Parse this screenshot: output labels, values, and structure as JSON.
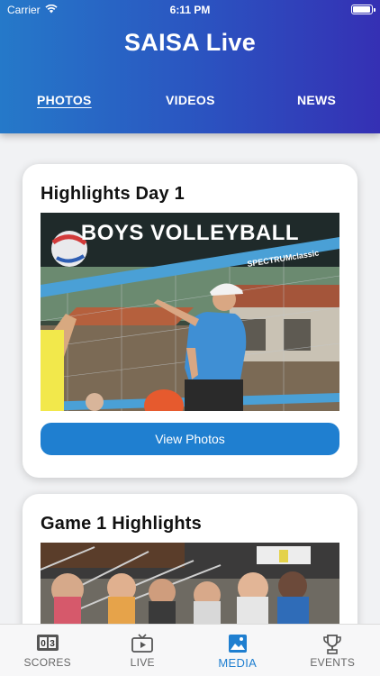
{
  "status_bar": {
    "carrier": "Carrier",
    "time": "6:11 PM"
  },
  "header": {
    "title": "SAISA Live"
  },
  "tabs": [
    {
      "label": "PHOTOS",
      "active": true
    },
    {
      "label": "VIDEOS",
      "active": false
    },
    {
      "label": "NEWS",
      "active": false
    }
  ],
  "cards": [
    {
      "title": "Highlights Day 1",
      "image_caption": "BOYS VOLLEYBALL",
      "net_branding": "SPECTRUMclassic",
      "button_label": "View Photos"
    },
    {
      "title": "Game 1 Highlights"
    }
  ],
  "bottom_nav": [
    {
      "label": "SCORES",
      "icon": "scoreboard-icon",
      "active": false
    },
    {
      "label": "LIVE",
      "icon": "live-tv-icon",
      "active": false
    },
    {
      "label": "MEDIA",
      "icon": "image-icon",
      "active": true
    },
    {
      "label": "EVENTS",
      "icon": "trophy-icon",
      "active": false
    }
  ],
  "colors": {
    "accent": "#1f7fd0",
    "header_start": "#2579c9",
    "header_end": "#3530b4"
  }
}
